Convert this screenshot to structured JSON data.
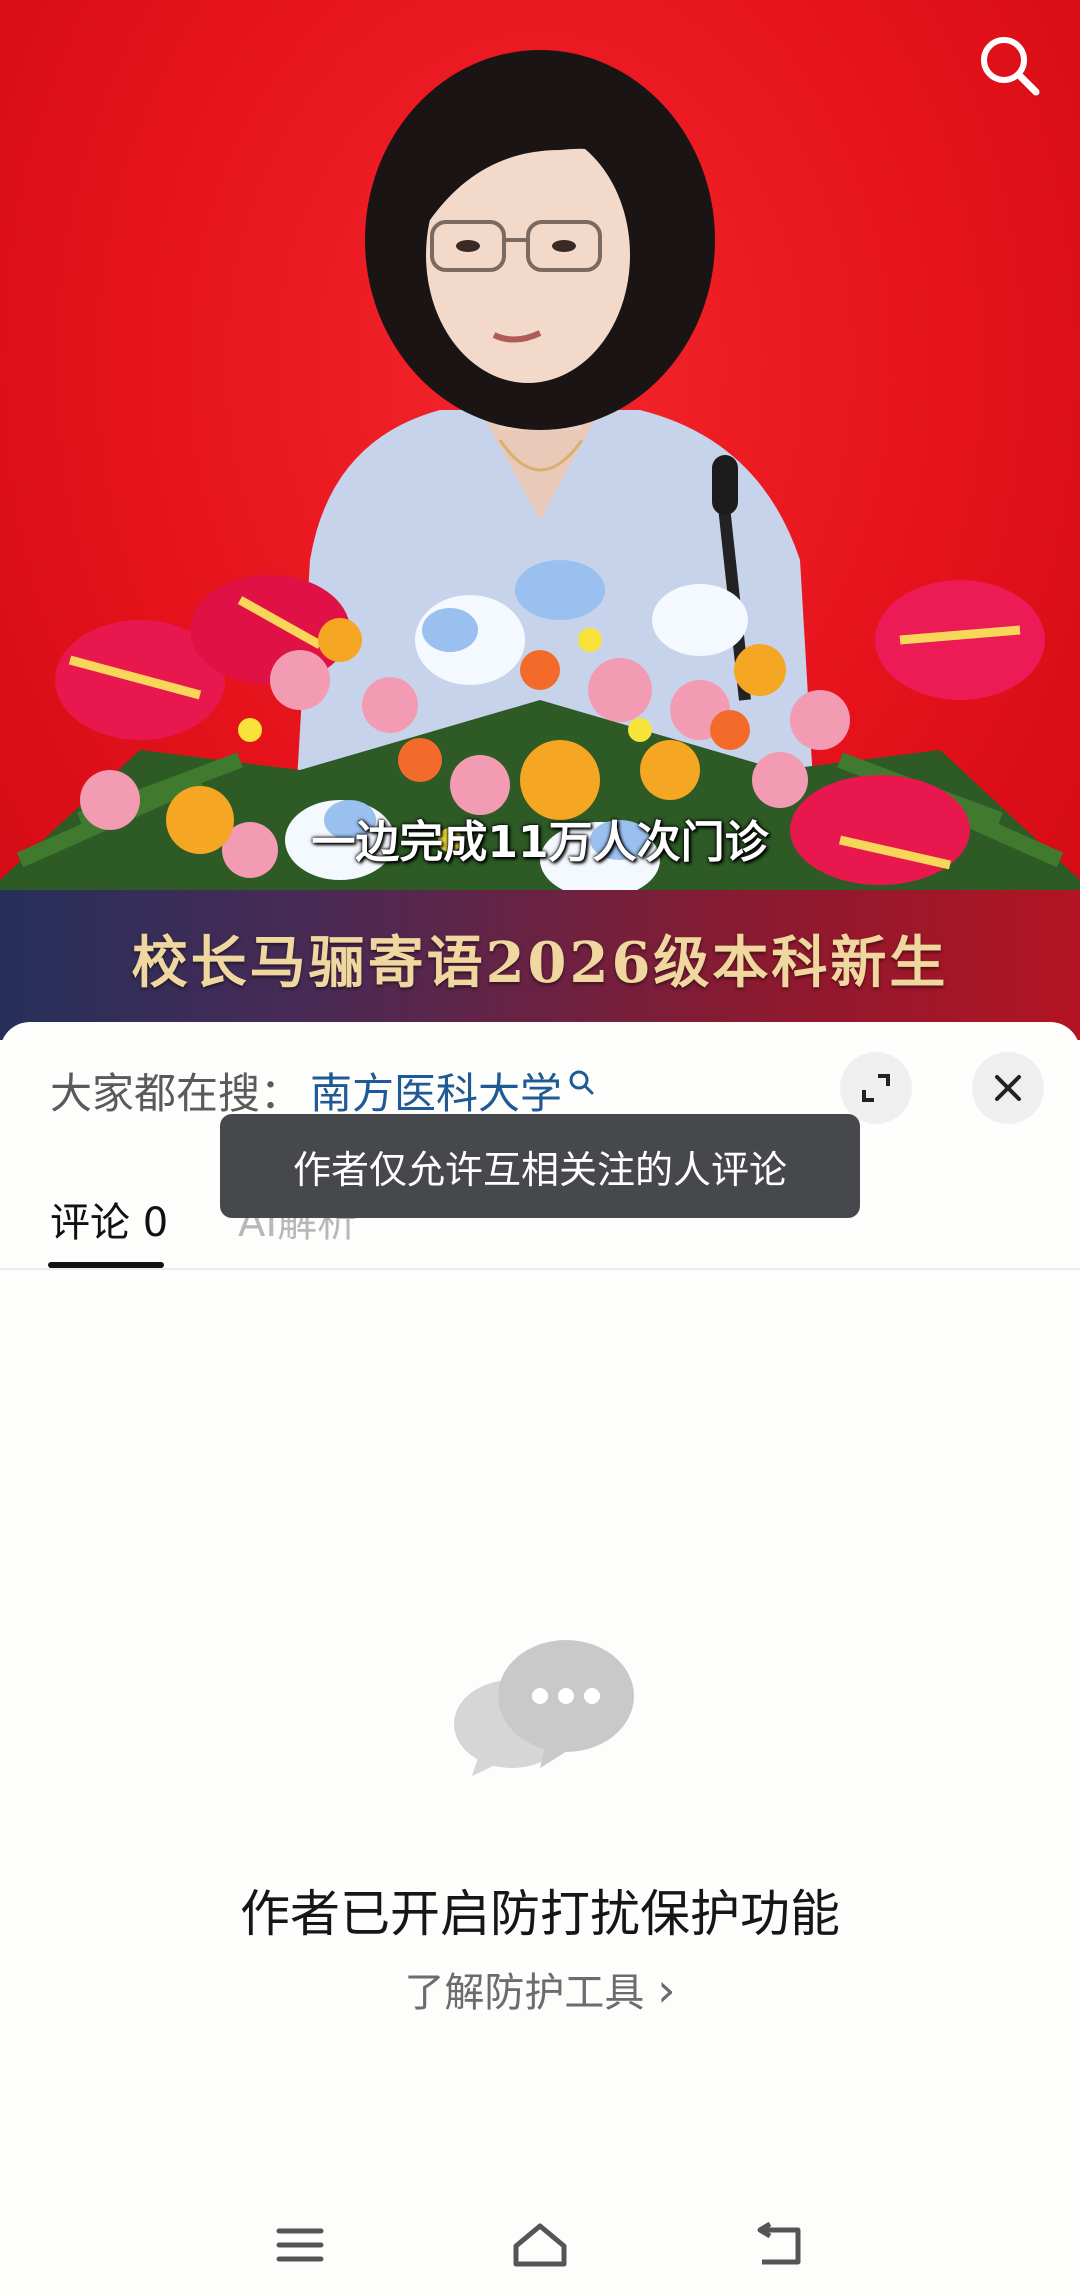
{
  "video": {
    "subtitle": "一边完成11万人次门诊",
    "banner_title": "校长马骊寄语2026级本科新生"
  },
  "comments_sheet": {
    "search_prefix": "大家都在搜：",
    "search_term": "南方医科大学",
    "toast": "作者仅允许互相关注的人评论",
    "tabs": [
      {
        "label": "评论",
        "count": "0"
      },
      {
        "label": "AI解析"
      }
    ],
    "empty_title": "作者已开启防打扰保护功能",
    "learn_link": "了解防护工具",
    "learn_chevron": "›"
  },
  "colors": {
    "video_bg": "#e5121b",
    "link_blue": "#1f5a96",
    "toast_bg": "#46484c",
    "banner_gold": "#f0d7a0"
  },
  "icons": [
    "search-icon",
    "expand-icon",
    "close-icon",
    "chat-bubbles-icon",
    "menu-icon",
    "home-icon",
    "back-icon"
  ]
}
